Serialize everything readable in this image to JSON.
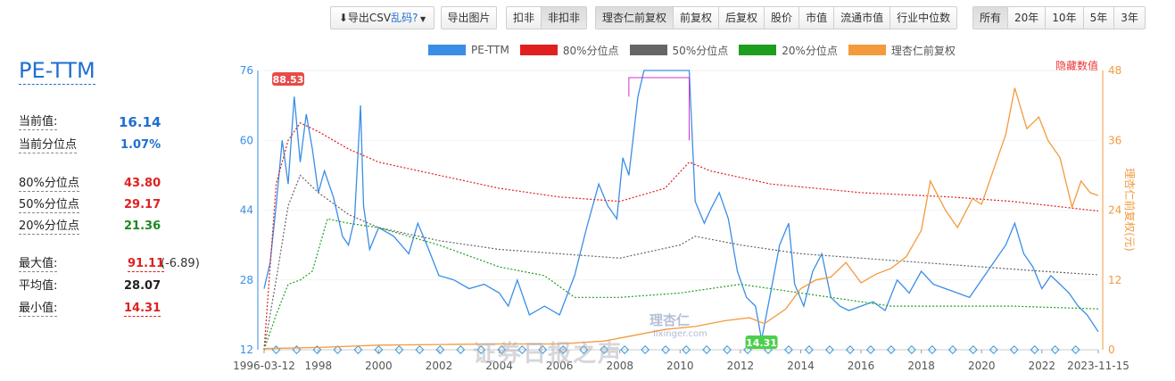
{
  "toolbar": {
    "export_prefix": "导出CSV",
    "export_link": "乱码?",
    "export_image": "导出图片",
    "adjust_group": [
      "扣非",
      "非扣非"
    ],
    "adjust_active": 1,
    "price_group": [
      "理杏仁前复权",
      "前复权",
      "后复权",
      "股价",
      "市值",
      "流通市值",
      "行业中位数"
    ],
    "price_active": 0,
    "range_group": [
      "所有",
      "20年",
      "10年",
      "5年",
      "3年"
    ],
    "range_active": 0
  },
  "legend": [
    {
      "label": "PE-TTM",
      "color": "#3a8ee6"
    },
    {
      "label": "80%分位点",
      "color": "#e02020"
    },
    {
      "label": "50%分位点",
      "color": "#666666"
    },
    {
      "label": "20%分位点",
      "color": "#1e9e1e"
    },
    {
      "label": "理杏仁前复权",
      "color": "#f39a3d"
    }
  ],
  "hide_values": "隐藏数值",
  "left_panel": {
    "title": "PE-TTM",
    "current_label": "当前值:",
    "current_value": "16.14",
    "current_pct_label": "当前分位点",
    "current_pct_value": "1.07%",
    "p80_label": "80%分位点",
    "p80_value": "43.80",
    "p50_label": "50%分位点",
    "p50_value": "29.17",
    "p20_label": "20%分位点",
    "p20_value": "21.36",
    "max_label": "最大值:",
    "max_value": "91.11",
    "max_extra": "(-6.89)",
    "avg_label": "平均值:",
    "avg_value": "28.07",
    "min_label": "最小值:",
    "min_value": "14.31"
  },
  "watermark": {
    "text": "证券日报之声",
    "logo": "理杏仁",
    "url": "lixinger.com"
  },
  "chart_data": {
    "type": "line",
    "x_tick_labels": [
      "1996-03-12",
      "1998",
      "2000",
      "2002",
      "2004",
      "2006",
      "2008",
      "2010",
      "2012",
      "2014",
      "2016",
      "2018",
      "2020",
      "2022",
      "2023-11-15"
    ],
    "x_range": [
      1996.2,
      2023.87
    ],
    "y_left_ticks": [
      12,
      28,
      44,
      60,
      76
    ],
    "y_left_range": [
      12,
      76
    ],
    "y_right_ticks": [
      0,
      12,
      24,
      36,
      48
    ],
    "y_right_range": [
      0,
      48
    ],
    "y_right_label": "理杏仁前复权(元)",
    "max_label": "88.53",
    "min_label": "14.31",
    "series": [
      {
        "name": "PE-TTM",
        "axis": "left",
        "color": "#3a8ee6",
        "x": [
          1996.2,
          1996.4,
          1996.6,
          1996.8,
          1997.0,
          1997.2,
          1997.4,
          1997.6,
          1997.8,
          1998.0,
          1998.2,
          1998.5,
          1998.8,
          1999.0,
          1999.2,
          1999.4,
          1999.5,
          1999.7,
          2000.0,
          2000.5,
          2001.0,
          2001.3,
          2001.6,
          2002.0,
          2002.5,
          2003.0,
          2003.5,
          2004.0,
          2004.3,
          2004.6,
          2005.0,
          2005.5,
          2006.0,
          2006.5,
          2006.9,
          2007.3,
          2007.6,
          2007.9,
          2008.1,
          2008.3,
          2008.6,
          2008.8,
          2009.2,
          2009.6,
          2010.0,
          2010.3,
          2010.5,
          2010.8,
          2011.0,
          2011.3,
          2011.6,
          2011.9,
          2012.2,
          2012.5,
          2012.7,
          2013.0,
          2013.3,
          2013.6,
          2013.8,
          2014.1,
          2014.4,
          2014.7,
          2015.0,
          2015.3,
          2015.6,
          2016.0,
          2016.4,
          2016.8,
          2017.2,
          2017.6,
          2018.0,
          2018.4,
          2018.8,
          2019.2,
          2019.6,
          2020.0,
          2020.4,
          2020.8,
          2021.1,
          2021.4,
          2021.7,
          2022.0,
          2022.3,
          2022.6,
          2022.9,
          2023.2,
          2023.5,
          2023.87
        ],
        "values": [
          26,
          32,
          45,
          60,
          50,
          70,
          55,
          66,
          58,
          48,
          53,
          47,
          38,
          36,
          42,
          68,
          45,
          35,
          40,
          38,
          34,
          41,
          36,
          29,
          28,
          26,
          27,
          25,
          22,
          28,
          20,
          22,
          20,
          29,
          40,
          50,
          45,
          42,
          56,
          52,
          70,
          88,
          88,
          88,
          88,
          85,
          46,
          41,
          44,
          48,
          42,
          30,
          24,
          22,
          14.31,
          25,
          36,
          41,
          27,
          22,
          30,
          34,
          24,
          22,
          21,
          22,
          23,
          21,
          28,
          25,
          30,
          27,
          26,
          25,
          24,
          28,
          32,
          36,
          41,
          34,
          31,
          26,
          29,
          27,
          25,
          22,
          20,
          16.14
        ]
      },
      {
        "name": "80%分位点",
        "axis": "left",
        "color": "#e02020",
        "x": [
          1996.2,
          1996.6,
          1997.0,
          1997.4,
          1998.0,
          1999.0,
          2000.0,
          2002.0,
          2004.0,
          2006.0,
          2008.0,
          2009.5,
          2010.3,
          2011.0,
          2013.0,
          2016.0,
          2019.0,
          2021.0,
          2023.87
        ],
        "values": [
          12,
          50,
          60,
          64,
          62,
          58,
          55,
          52,
          49,
          47,
          46,
          49,
          55,
          53,
          50,
          48,
          47,
          46,
          43.8
        ]
      },
      {
        "name": "50%分位点",
        "axis": "left",
        "color": "#666666",
        "x": [
          1996.2,
          1996.6,
          1997.0,
          1997.4,
          1998.0,
          1999.0,
          2000.0,
          2002.0,
          2004.0,
          2006.0,
          2008.0,
          2010.0,
          2010.5,
          2012.0,
          2014.0,
          2016.0,
          2018.0,
          2020.0,
          2022.0,
          2023.87
        ],
        "values": [
          12,
          28,
          45,
          52,
          48,
          43,
          40,
          37,
          35,
          34,
          33,
          36,
          38,
          36,
          34,
          33,
          32,
          31,
          30,
          29.17
        ]
      },
      {
        "name": "20%分位点",
        "axis": "left",
        "color": "#1e9e1e",
        "x": [
          1996.2,
          1996.6,
          1997.0,
          1997.4,
          1997.8,
          1998.3,
          1999.0,
          2000.0,
          2002.0,
          2004.0,
          2005.5,
          2006.5,
          2008.0,
          2010.0,
          2012.0,
          2013.0,
          2015.0,
          2017.0,
          2019.0,
          2021.0,
          2023.87
        ],
        "values": [
          12,
          20,
          27,
          28,
          30,
          42,
          41,
          40,
          36,
          31,
          29,
          24,
          24,
          25,
          27,
          26,
          24,
          22,
          22,
          22,
          21.36
        ]
      },
      {
        "name": "理杏仁前复权",
        "axis": "right",
        "color": "#f39a3d",
        "x": [
          1996.2,
          1998.0,
          2000.0,
          2002.0,
          2004.0,
          2006.0,
          2007.5,
          2008.5,
          2009.5,
          2010.5,
          2011.5,
          2012.3,
          2012.8,
          2013.5,
          2014.0,
          2014.5,
          2015.0,
          2015.5,
          2016.0,
          2016.5,
          2017.0,
          2017.5,
          2018.0,
          2018.3,
          2018.8,
          2019.2,
          2019.7,
          2020.0,
          2020.4,
          2020.8,
          2021.1,
          2021.5,
          2021.9,
          2022.2,
          2022.6,
          2023.0,
          2023.3,
          2023.6,
          2023.87
        ],
        "values": [
          0.2,
          0.4,
          0.8,
          0.9,
          1.0,
          1.0,
          1.5,
          2.5,
          3.5,
          4.0,
          5.0,
          5.5,
          4.5,
          7.0,
          10.5,
          12.0,
          12.5,
          15.0,
          11.5,
          13.0,
          14.0,
          16.0,
          20.5,
          29.0,
          24.0,
          21.0,
          26.0,
          25.0,
          31.0,
          37.0,
          45.0,
          38.0,
          40.0,
          36.0,
          33.0,
          24.5,
          29.0,
          27.0,
          26.5
        ]
      }
    ]
  }
}
